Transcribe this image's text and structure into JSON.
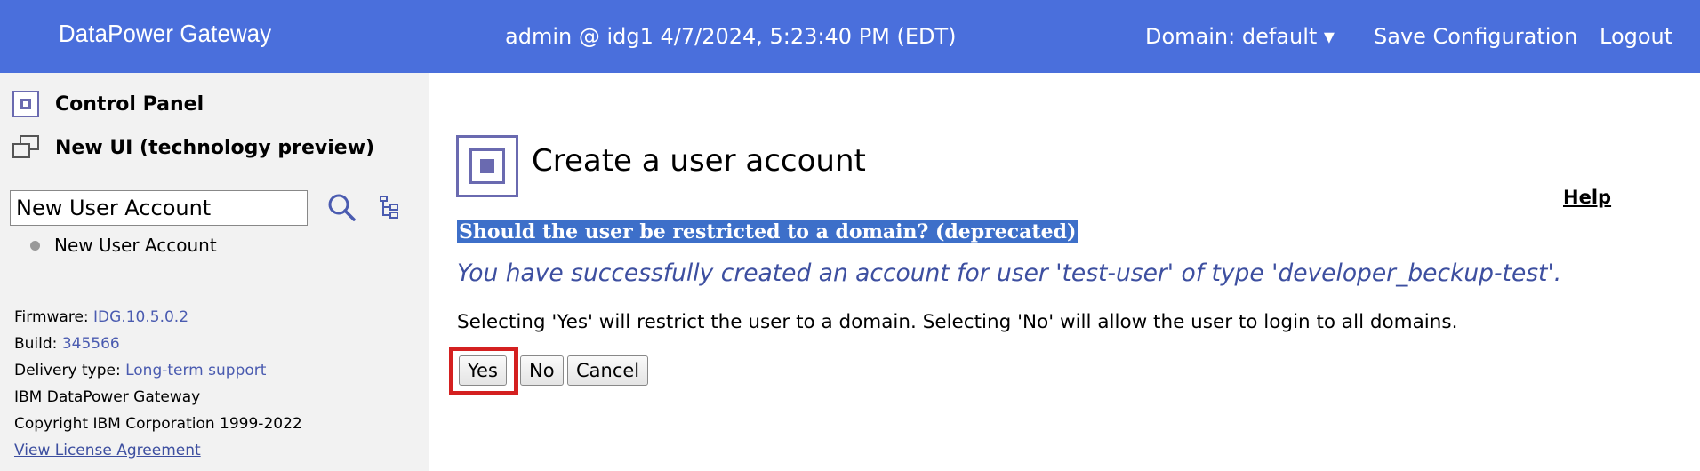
{
  "header": {
    "brand": "DataPower Gateway",
    "session": "admin @ idg1 4/7/2024, 5:23:40 PM (EDT)",
    "domain": "Domain: default ▾",
    "save": "Save Configuration",
    "logout": "Logout",
    "background": "#4a6fdc"
  },
  "sidebar": {
    "control_panel": "Control Panel",
    "new_ui": "New UI (technology preview)",
    "search_value": "New User Account",
    "result": "New User Account",
    "firmware_label": "Firmware:",
    "firmware_value": "IDG.10.5.0.2",
    "build_label": "Build:",
    "build_value": "345566",
    "delivery_label": "Delivery type:",
    "delivery_value": "Long-term support",
    "product": "IBM DataPower Gateway",
    "copyright": "Copyright IBM Corporation 1999-2022",
    "license": "View License Agreement"
  },
  "main": {
    "title": "Create a user account",
    "help": "Help",
    "question": "Should the user be restricted to a domain? (deprecated)",
    "success": "You have successfully created an account for user 'test-user' of type 'developer_beckup-test'.",
    "info": "Selecting 'Yes' will restrict the user to a domain. Selecting 'No' will allow the user to login to all domains.",
    "buttons": {
      "yes": "Yes",
      "no": "No",
      "cancel": "Cancel"
    }
  },
  "icons": [
    "control-panel-icon",
    "new-ui-icon",
    "search-icon",
    "tree-view-icon",
    "create-user-icon"
  ]
}
